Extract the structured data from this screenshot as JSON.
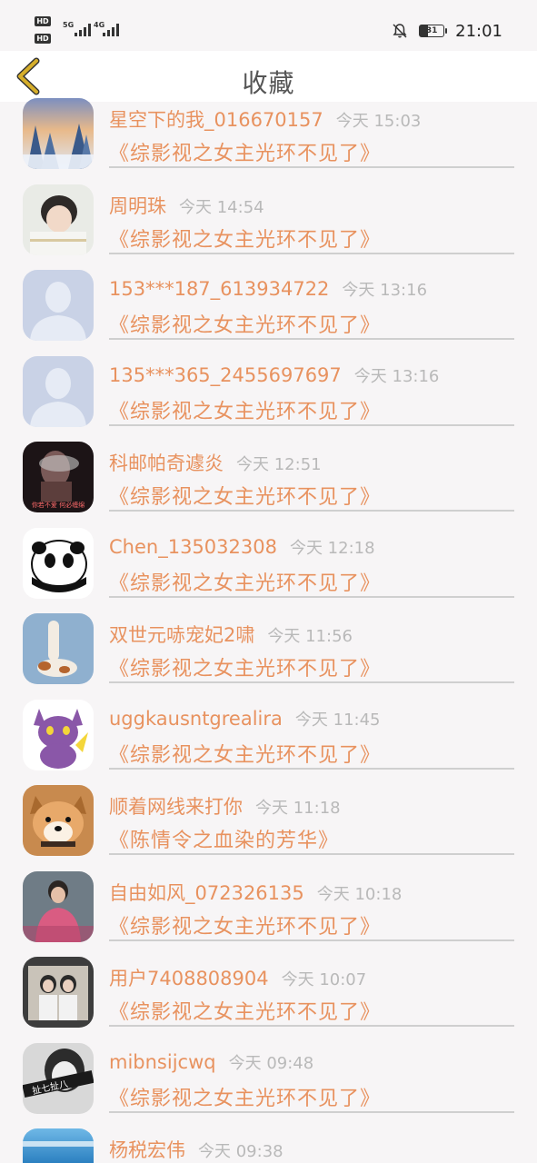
{
  "status_bar": {
    "hd1": "HD",
    "hd2": "HD",
    "sim1_network": "5G",
    "sim2_network": "4G",
    "battery": "31",
    "time": "21:01"
  },
  "header": {
    "title": "收藏"
  },
  "colors": {
    "accent": "#e8925f",
    "back_arrow": "#d6ae2a",
    "timestamp": "#b9b9b9"
  },
  "favorites": [
    {
      "user": "星空下的我_016670157",
      "time": "今天 15:03",
      "novel": "《综影视之女主光环不见了》",
      "avatar": "snowy-forest-avatar"
    },
    {
      "user": "周明珠",
      "time": "今天 14:54",
      "novel": "《综影视之女主光环不见了》",
      "avatar": "boy-photo-avatar"
    },
    {
      "user": "153***187_613934722",
      "time": "今天 13:16",
      "novel": "《综影视之女主光环不见了》",
      "avatar": "default-avatar"
    },
    {
      "user": "135***365_2455697697",
      "time": "今天 13:16",
      "novel": "《综影视之女主光环不见了》",
      "avatar": "default-avatar"
    },
    {
      "user": "科邮帕奇遽炎",
      "time": "今天 12:51",
      "novel": "《综影视之女主光环不见了》",
      "avatar": "smoke-photo-avatar"
    },
    {
      "user": "Chen_135032308",
      "time": "今天 12:18",
      "novel": "《综影视之女主光环不见了》",
      "avatar": "panda-avatar"
    },
    {
      "user": "双世元哧宠妃2啸",
      "time": "今天 11:56",
      "novel": "《综影视之女主光环不见了》",
      "avatar": "dog-stretch-avatar"
    },
    {
      "user": "uggkausntgrealira",
      "time": "今天 11:45",
      "novel": "《综影视之女主光环不见了》",
      "avatar": "purple-pikachu-avatar"
    },
    {
      "user": "顺着网线来打你",
      "time": "今天 11:18",
      "novel": "《陈情令之血染的芳华》",
      "avatar": "shiba-avatar"
    },
    {
      "user": "自由如风_072326135",
      "time": "今天 10:18",
      "novel": "《综影视之女主光环不见了》",
      "avatar": "girl-photo-avatar"
    },
    {
      "user": "用户7408808904",
      "time": "今天 10:07",
      "novel": "《综影视之女主光环不见了》",
      "avatar": "couple-photo-avatar"
    },
    {
      "user": "mibnsijcwq",
      "time": "今天 09:48",
      "novel": "《综影视之女主光环不见了》",
      "avatar": "bw-girl-avatar"
    },
    {
      "user": "杨税宏伟",
      "time": "今天 09:38",
      "novel": "",
      "avatar": "sea-avatar"
    }
  ],
  "avatar_captions": {
    "smoke": "你若不爱 何必缠绵",
    "bw_girl": "扯七扯八"
  }
}
